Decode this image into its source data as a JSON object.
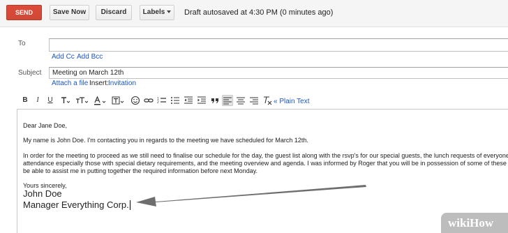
{
  "toolbar": {
    "send_label": "SEND",
    "save_label": "Save Now",
    "discard_label": "Discard",
    "labels_label": "Labels",
    "draft_status": "Draft autosaved at 4:30 PM (0 minutes ago)"
  },
  "header": {
    "to_label": "To",
    "to_value": "",
    "add_cc": "Add Cc",
    "add_bcc": "Add Bcc",
    "subject_label": "Subject",
    "subject_value": "Meeting on March 12th",
    "attach_label": "Attach a file",
    "insert_label": "Insert:",
    "insert_invitation": "Invitation"
  },
  "format_bar": {
    "bold": "B",
    "italic": "I",
    "underline": "U",
    "plain_text_link": "« Plain Text",
    "icons": [
      "font-icon",
      "font-size-icon",
      "text-color-icon",
      "highlight-color-icon",
      "emoji-icon",
      "link-icon",
      "numbered-list-icon",
      "bulleted-list-icon",
      "indent-less-icon",
      "indent-more-icon",
      "quote-icon",
      "align-left-icon",
      "align-center-icon",
      "align-right-icon",
      "remove-formatting-icon"
    ]
  },
  "body": {
    "greeting": "Dear Jane Doe,",
    "intro": "My name is John Doe. I'm contacting you in regards to the meeting we have scheduled for March 12th.",
    "line1": "In order for the meeting to proceed as we still need to finalise our schedule for the day, the guest list along with the rsvp's for our special guests, the lunch requests of everyone",
    "line2": "attendance especially those with special dietary requirements, and the meeting overview and agenda. I was informed by Roger that you will be in possession of some of these",
    "line3": "be able to assist me in putting together the required information before next Monday.",
    "closing": "Yours sincerely,",
    "name": "John Doe",
    "title": "Manager Everything Corp."
  },
  "watermark": "wikiHow",
  "colors": {
    "send": "#d14836",
    "link": "#1a56c8",
    "arrow": "#6e6e6e"
  }
}
